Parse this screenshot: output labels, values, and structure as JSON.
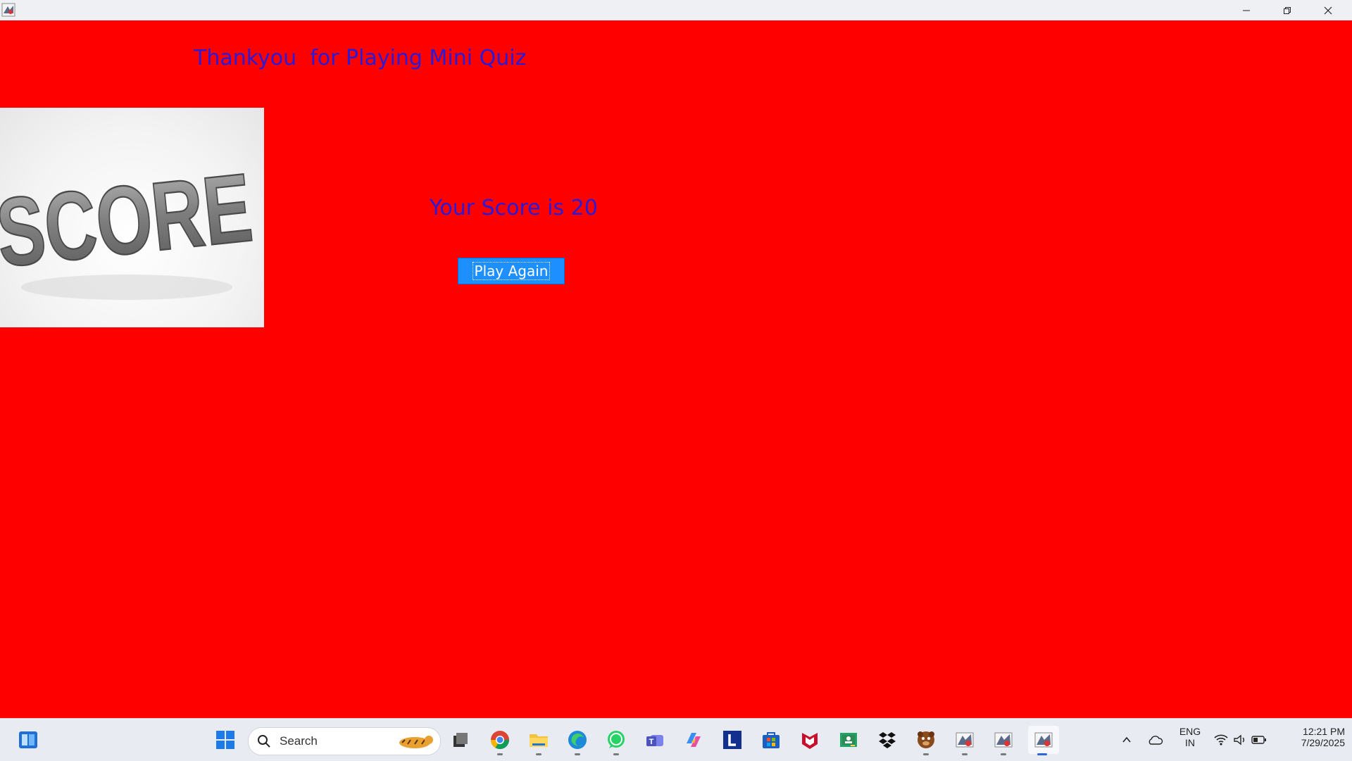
{
  "window": {
    "icon": "java-app-icon",
    "controls": {
      "minimize": "minimize-icon",
      "restore": "restore-icon",
      "close": "close-icon"
    }
  },
  "app": {
    "heading": "Thankyou  for Playing Mini Quiz",
    "image_label": "SCORE",
    "score_text": "Your Score is 20",
    "play_again_label": "Play Again",
    "colors": {
      "background": "#ff0000",
      "text": "#2a1bd8",
      "button": "#1e8fff",
      "button_text": "#ffffff"
    }
  },
  "taskbar": {
    "search_label": "Search",
    "apps": [
      "widgets-icon",
      "start-icon",
      "task-view-icon",
      "chrome-icon",
      "file-explorer-icon",
      "edge-icon",
      "whatsapp-icon",
      "teams-icon",
      "copilot-icon",
      "l-app-icon",
      "store-icon",
      "mcafee-icon",
      "classroom-icon",
      "dropbox-icon",
      "bear-app-icon",
      "java-app-icon",
      "java-app-icon",
      "java-app-icon"
    ],
    "tray": {
      "language_line1": "ENG",
      "language_line2": "IN",
      "time": "12:21 PM",
      "date": "7/29/2025"
    }
  }
}
